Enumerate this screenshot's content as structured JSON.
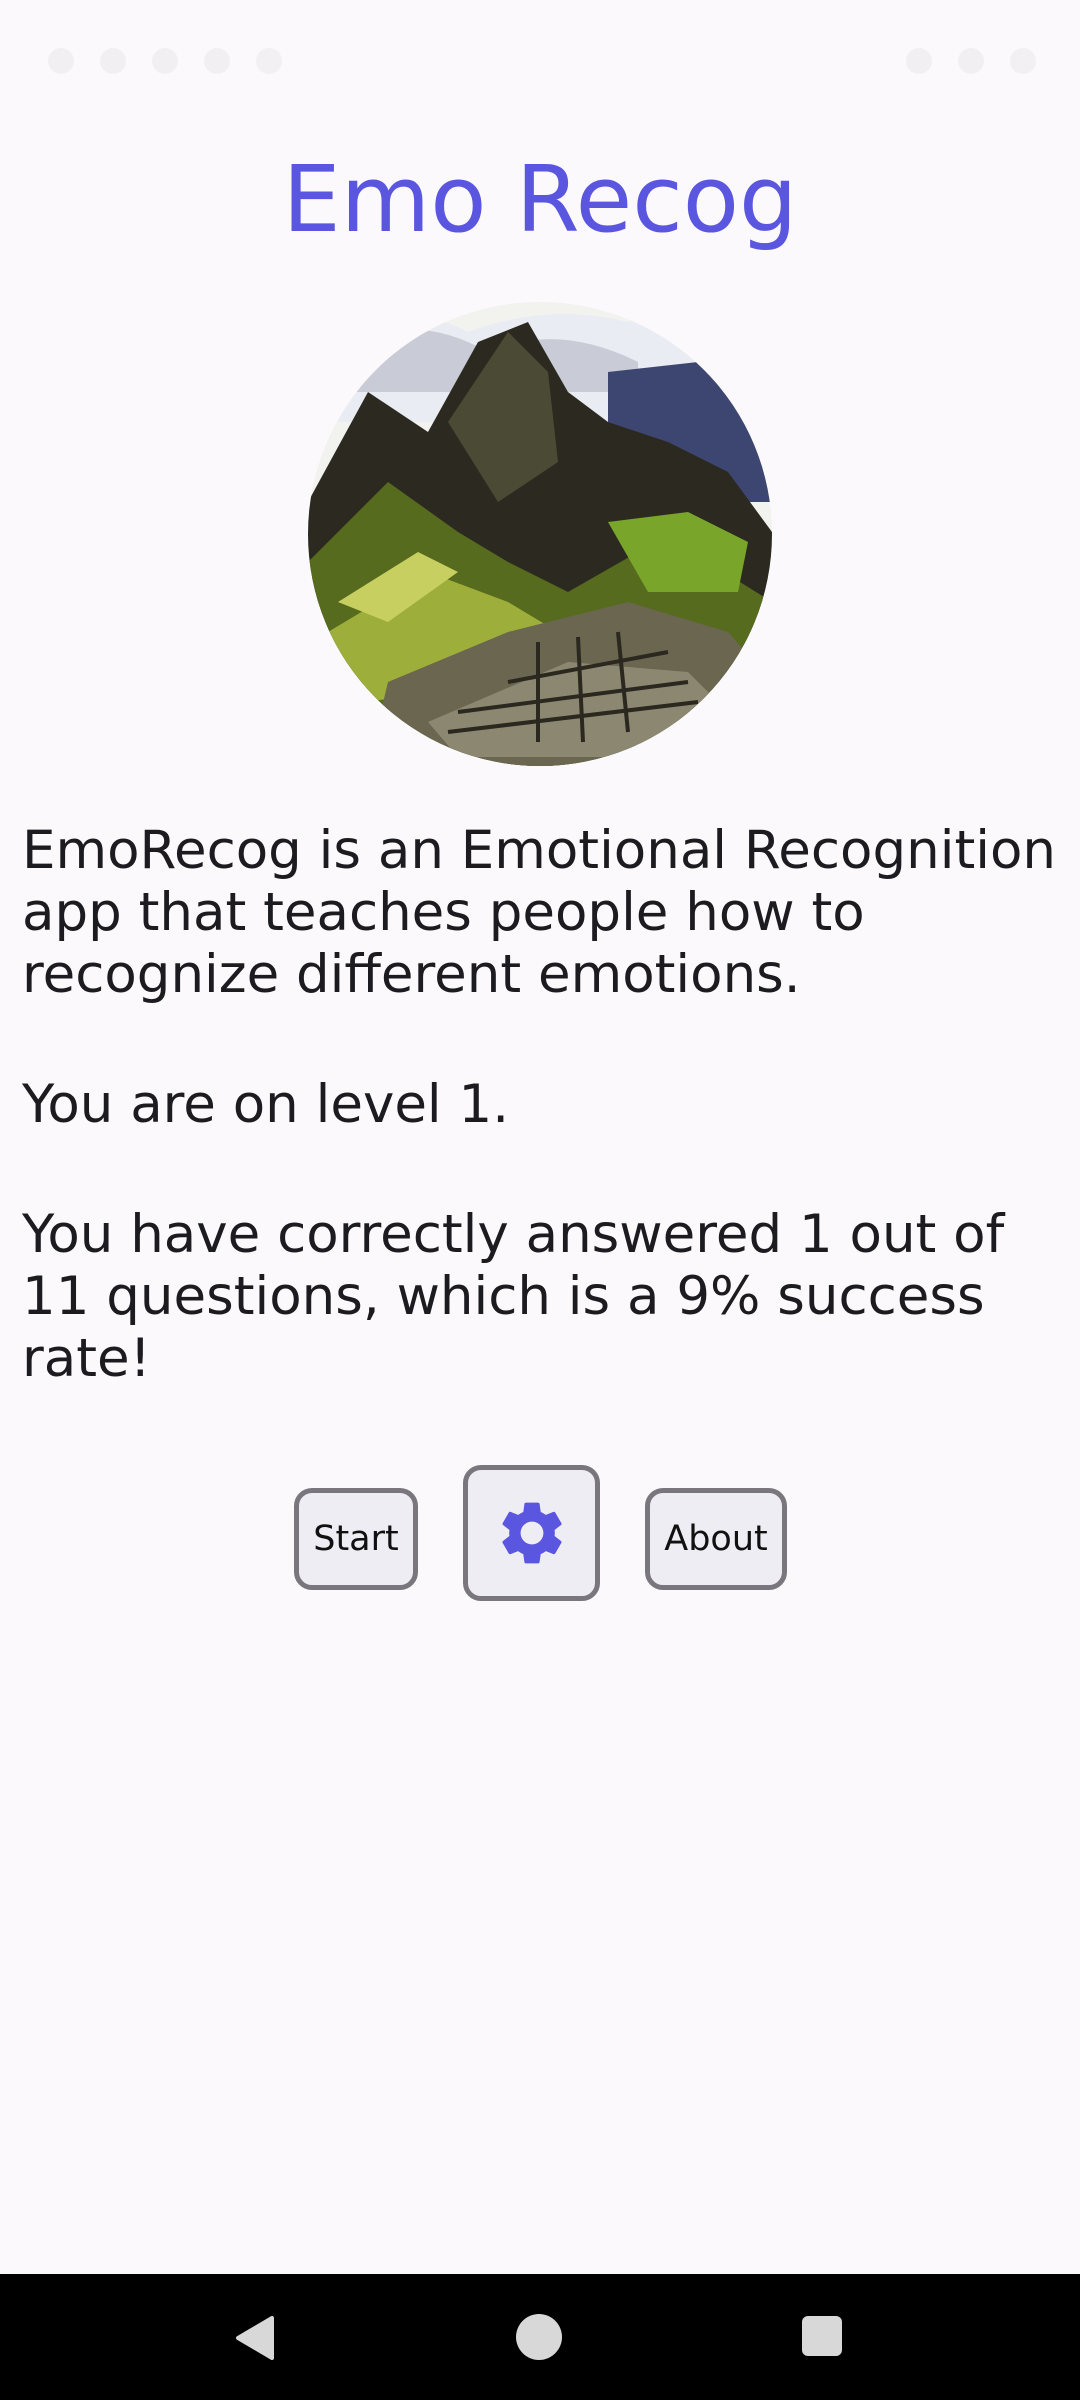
{
  "app": {
    "title": "Emo Recog"
  },
  "hero_image": {
    "description_icon": "mountain-ruins-photo"
  },
  "content": {
    "description": "EmoRecog is an Emotional Recognition app that teaches people how to recognize different emotions.",
    "level_text": "You are on level 1.",
    "score_text": "You have correctly answered 1 out of 11 questions, which is a 9% success rate!"
  },
  "actions": {
    "start_label": "Start",
    "settings_icon": "gear-icon",
    "about_label": "About"
  },
  "navigation": {
    "back_icon": "back-triangle-icon",
    "home_icon": "home-circle-icon",
    "recent_icon": "recent-square-icon"
  },
  "colors": {
    "accent": "#5b56e0",
    "background": "#fcf9fd",
    "button_border": "#79767d",
    "button_fill": "#efedf4"
  }
}
